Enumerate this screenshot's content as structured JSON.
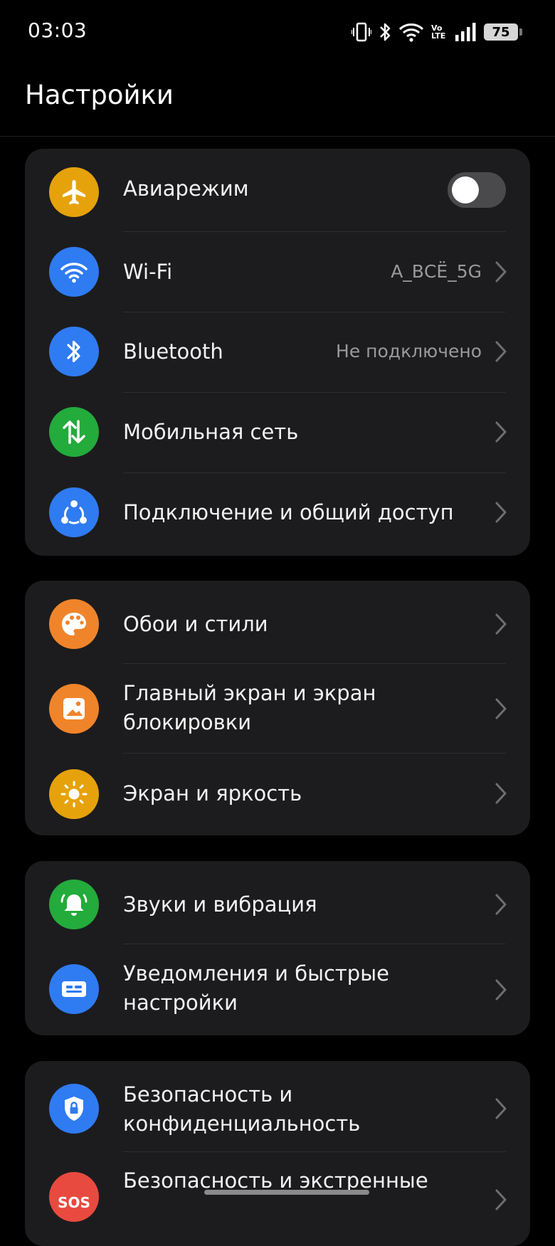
{
  "status_bar": {
    "time": "03:03",
    "battery_level": "75",
    "volte_label": "Vo LTE",
    "icons": [
      "vibrate-icon",
      "bluetooth-icon",
      "wifi-icon",
      "volte-icon",
      "signal-icon",
      "battery-icon"
    ]
  },
  "page": {
    "title": "Настройки"
  },
  "groups": [
    {
      "items": [
        {
          "label": "Авиарежим",
          "icon": "airplane-icon",
          "color": "#e6a20b",
          "toggle_on": false
        },
        {
          "label": "Wi-Fi",
          "icon": "wifi-icon",
          "color": "#2f7bf2",
          "value": "A_ВСЁ_5G"
        },
        {
          "label": "Bluetooth",
          "icon": "bluetooth-icon",
          "color": "#2f7bf2",
          "value": "Не подключено"
        },
        {
          "label": "Мобильная сеть",
          "icon": "mobile-data-icon",
          "color": "#23ab3c"
        },
        {
          "label": "Подключение и общий доступ",
          "icon": "share-icon",
          "color": "#2f7bf2"
        }
      ]
    },
    {
      "items": [
        {
          "label": "Обои и стили",
          "icon": "palette-icon",
          "color": "#f0842a"
        },
        {
          "label": "Главный экран и экран блокировки",
          "icon": "wallpaper-icon",
          "color": "#f0842a"
        },
        {
          "label": "Экран и яркость",
          "icon": "brightness-icon",
          "color": "#e6a20b"
        }
      ]
    },
    {
      "items": [
        {
          "label": "Звуки и вибрация",
          "icon": "bell-icon",
          "color": "#23ab3c"
        },
        {
          "label": "Уведомления и быстрые настройки",
          "icon": "notification-icon",
          "color": "#2f7bf2"
        }
      ]
    },
    {
      "items": [
        {
          "label": "Безопасность и конфиденциальность",
          "icon": "shield-lock-icon",
          "color": "#2f7bf2"
        },
        {
          "label": "Безопасность и экстренные",
          "icon": "sos-icon",
          "color": "#e84a3f",
          "icon_text": "SOS"
        }
      ]
    }
  ]
}
